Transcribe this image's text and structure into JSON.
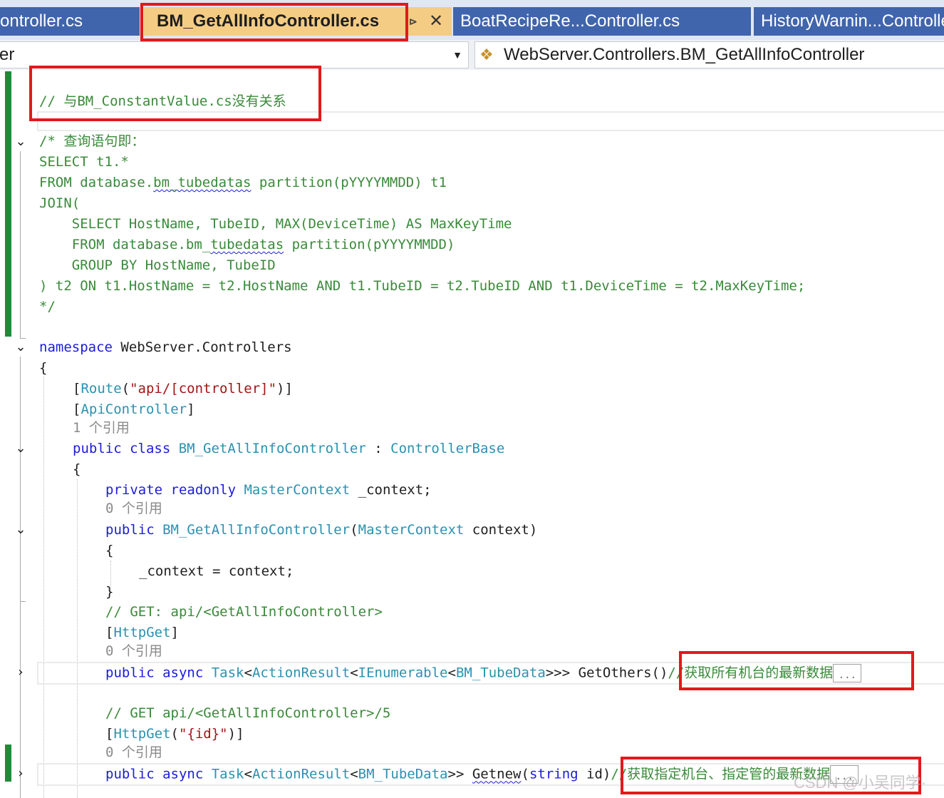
{
  "tabs": [
    {
      "label": "ontroller.cs",
      "active": false
    },
    {
      "label": "BM_GetAllInfoController.cs",
      "active": true,
      "pin": "⊳",
      "close": "✕"
    },
    {
      "label": "BoatRecipeRe...Controller.cs",
      "active": false
    },
    {
      "label": "HistoryWarnin...Controller.cs",
      "active": false
    }
  ],
  "nav": {
    "left_text": "er",
    "left_dropdown_icon": "▼",
    "right_icon": "class-icon",
    "right_icon_glyph": "❖",
    "right_text": "WebServer.Controllers.BM_GetAllInfoController"
  },
  "code": {
    "top_comment": "// 与BM_ConstantValue.cs没有关系",
    "sql_open": "/* 查询语句即：",
    "sql_select": "SELECT t1.*",
    "sql_from_a": "FROM database.",
    "sql_table": "bm_tubedatas",
    "sql_from_b": " partition(pYYYYMMDD) t1",
    "sql_join": "JOIN(",
    "sql_sub_select": "    SELECT HostName, TubeID, MAX(DeviceTime) AS MaxKeyTime",
    "sql_sub_from_a": "    FROM database.bm_",
    "sql_sub_table": "tubedatas",
    "sql_sub_from_b": " partition(pYYYYMMDD)",
    "sql_groupby": "    GROUP BY HostName, TubeID",
    "sql_on": ") t2 ON t1.HostName = t2.HostName AND t1.TubeID = t2.TubeID AND t1.DeviceTime = t2.MaxKeyTime;",
    "sql_close": "*/",
    "ns_kw": "namespace",
    "ns_name": " WebServer.Controllers",
    "ns_open": "{",
    "route_open": "[",
    "route_attr": "Route",
    "route_paren": "(",
    "route_str": "\"api/[controller]\"",
    "route_close": ")]",
    "api_open": "[",
    "api_attr": "ApiController",
    "api_close": "]",
    "class_refs": "1 个引用",
    "class_kw": "public class ",
    "class_name": "BM_GetAllInfoController",
    "class_colon": " : ",
    "class_base": "ControllerBase",
    "class_open": "{",
    "field_kw": "private readonly ",
    "field_type": "MasterContext",
    "field_name": " _context;",
    "ctor_refs": "0 个引用",
    "ctor_kw": "public ",
    "ctor_name": "BM_GetAllInfoController",
    "ctor_paren": "(",
    "ctor_ptype": "MasterContext",
    "ctor_pname": " context)",
    "ctor_open": "{",
    "ctor_body": "_context = context;",
    "ctor_close": "}",
    "get_comment": "// GET: api/<GetAllInfoController>",
    "httpget_open": "[",
    "httpget_attr": "HttpGet",
    "httpget_close": "]",
    "others_refs": "0 个引用",
    "others_kw": "public async ",
    "others_t1": "Task",
    "others_lt1": "<",
    "others_t2": "ActionResult",
    "others_lt2": "<",
    "others_t3": "IEnumerable",
    "others_lt3": "<",
    "others_t4": "BM_TubeData",
    "others_gt": ">>> ",
    "others_name": "GetOthers",
    "others_paren": "()",
    "others_comment": "//获取所有机台的最新数据",
    "collapsed": "...",
    "getid_comment": "// GET api/<GetAllInfoController>/5",
    "httpget2_open": "[",
    "httpget2_attr": "HttpGet",
    "httpget2_paren": "(",
    "httpget2_str": "\"{id}\"",
    "httpget2_close": ")]",
    "new_refs": "0 个引用",
    "new_kw": "public async ",
    "new_t1": "Task",
    "new_lt1": "<",
    "new_t2": "ActionResult",
    "new_lt2": "<",
    "new_t3": "BM_TubeData",
    "new_gt": ">> ",
    "new_name": "Getnew",
    "new_paren": "(",
    "new_ptype": "string",
    "new_pname": " id)",
    "new_comment": "//获取指定机台、指定管的最新数据"
  },
  "watermark": "CSDN @小吴同学·",
  "colors": {
    "keyword": "#1c1cdb",
    "type": "#2b91af",
    "comment": "#3a8a3a",
    "string": "#a31515",
    "highlight": "#e3191b",
    "tab_active": "#f5cc84",
    "tab_inactive": "#4065ad"
  }
}
